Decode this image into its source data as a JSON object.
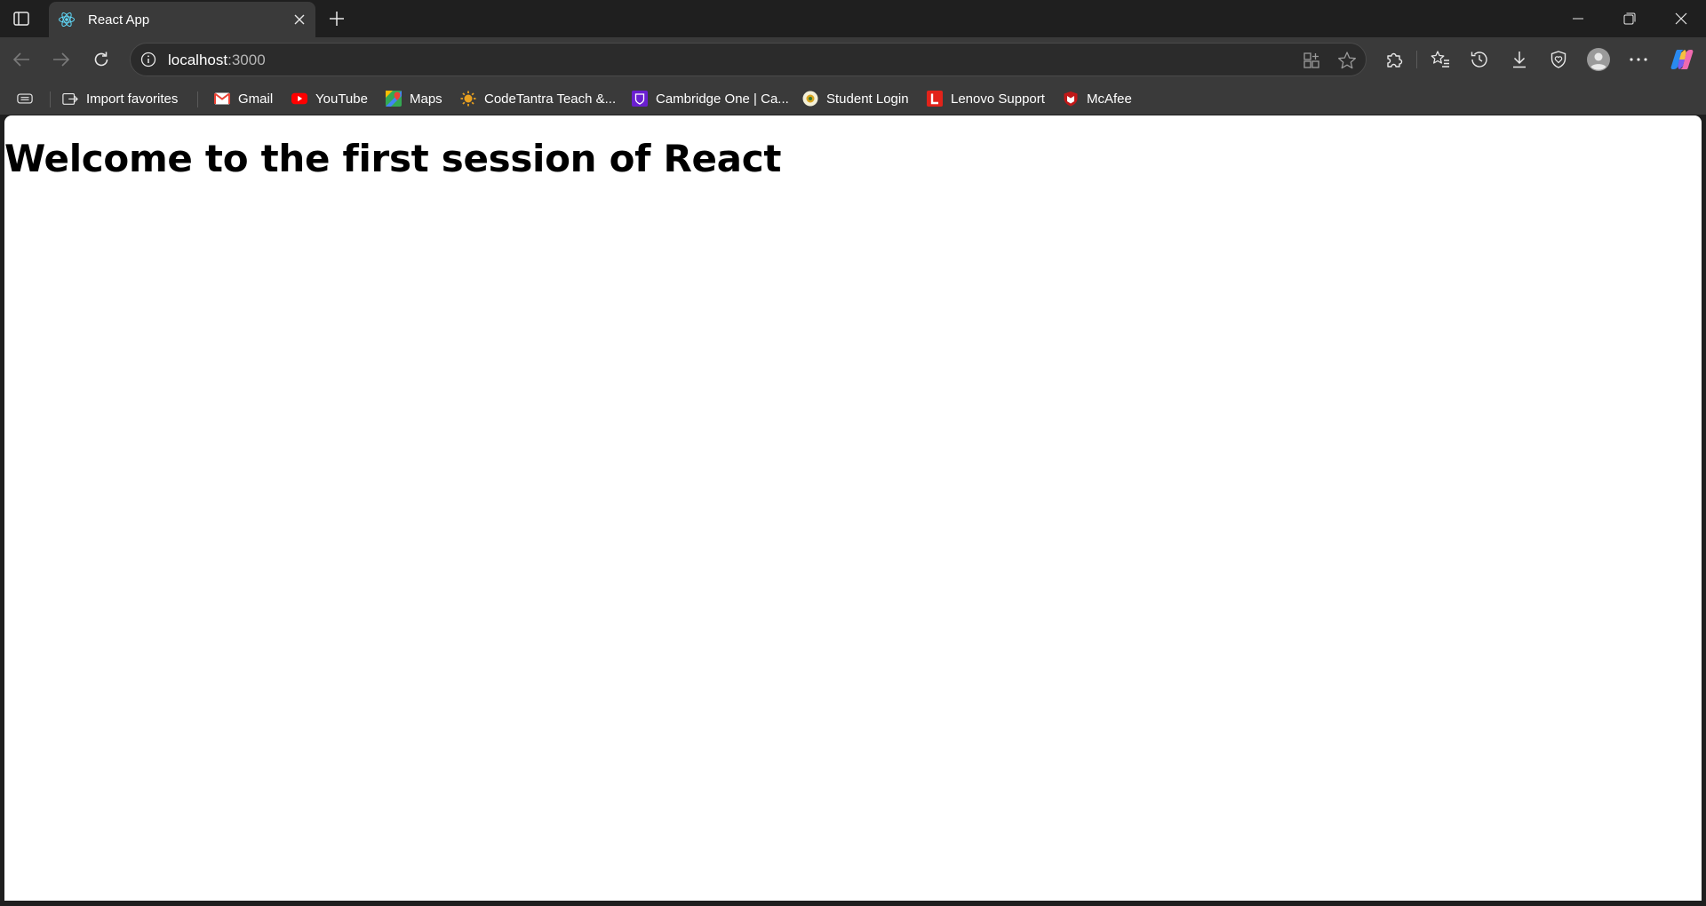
{
  "window": {
    "tab_title": "React App"
  },
  "toolbar": {
    "url_host": "localhost",
    "url_port": ":3000"
  },
  "bookmarks": [
    {
      "label": "Import favorites",
      "icon": "import-favorites-icon"
    },
    {
      "label": "Gmail",
      "icon": "gmail-icon",
      "color": "#ea4335"
    },
    {
      "label": "YouTube",
      "icon": "youtube-icon",
      "color": "#ff0000"
    },
    {
      "label": "Maps",
      "icon": "maps-icon"
    },
    {
      "label": "CodeTantra Teach &...",
      "icon": "codetantra-icon",
      "color": "#e8a020"
    },
    {
      "label": "Cambridge One | Ca...",
      "icon": "cambridge-one-icon",
      "color": "#6a1fd0"
    },
    {
      "label": "Student Login",
      "icon": "student-login-icon"
    },
    {
      "label": "Lenovo Support",
      "icon": "lenovo-icon",
      "color": "#e2231a"
    },
    {
      "label": "McAfee",
      "icon": "mcafee-icon",
      "color": "#c01818"
    }
  ],
  "page": {
    "heading": "Welcome to the first session of React"
  }
}
